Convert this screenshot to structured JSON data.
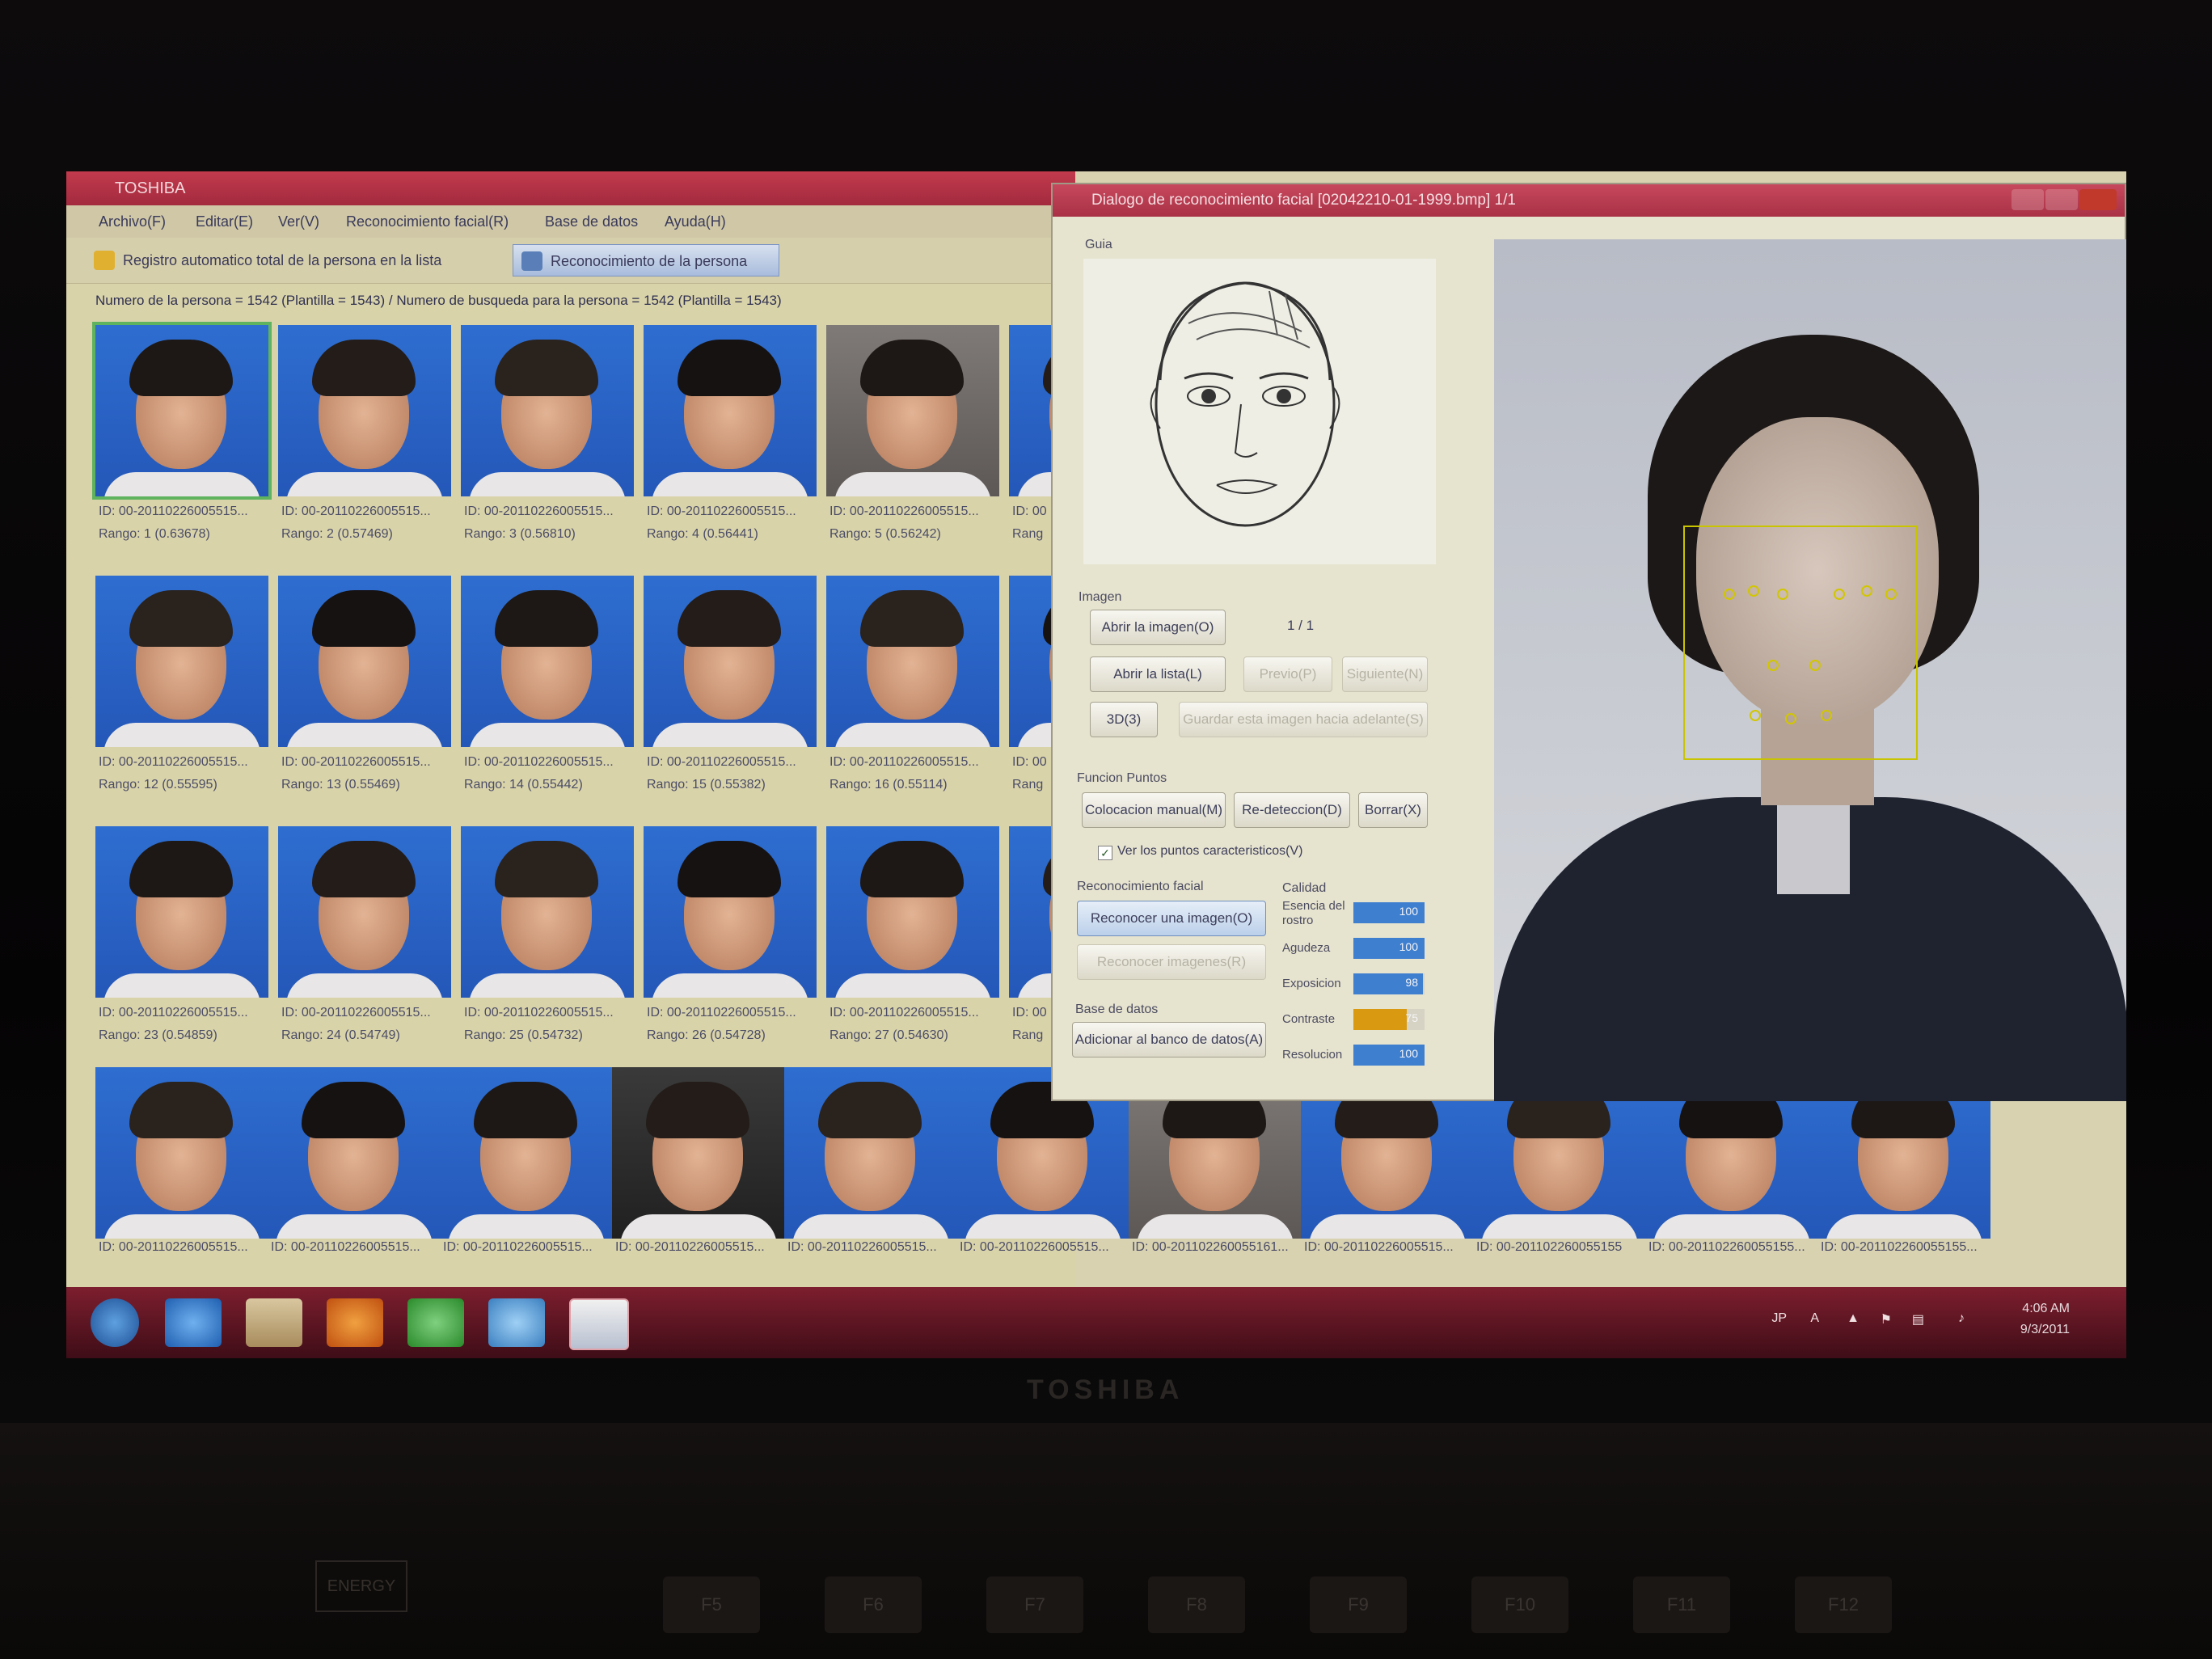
{
  "main_window": {
    "title": "TOSHIBA",
    "menu": [
      "Archivo(F)",
      "Editar(E)",
      "Ver(V)",
      "Reconocimiento facial(R)",
      "Base de datos",
      "Ayuda(H)"
    ],
    "toolbar": {
      "auto_register_label": "Registro automatico total de la persona en la lista",
      "person_recognition_label": "Reconocimiento de la persona"
    },
    "info_line": "Numero de la persona = 1542 (Plantilla = 1543)  /  Numero de busqueda para la persona = 1542 (Plantilla = 1543)",
    "results": [
      {
        "id": "ID: 00-20110226005515...",
        "rank": "Rango: 1 (0.63678)"
      },
      {
        "id": "ID: 00-20110226005515...",
        "rank": "Rango: 2 (0.57469)"
      },
      {
        "id": "ID: 00-20110226005515...",
        "rank": "Rango: 3 (0.56810)"
      },
      {
        "id": "ID: 00-20110226005515...",
        "rank": "Rango: 4 (0.56441)"
      },
      {
        "id": "ID: 00-20110226005515...",
        "rank": "Rango: 5 (0.56242)"
      },
      {
        "id": "ID: 00",
        "rank": "Rang"
      },
      {
        "id": "ID: 00-20110226005515...",
        "rank": "Rango: 12 (0.55595)"
      },
      {
        "id": "ID: 00-20110226005515...",
        "rank": "Rango: 13 (0.55469)"
      },
      {
        "id": "ID: 00-20110226005515...",
        "rank": "Rango: 14 (0.55442)"
      },
      {
        "id": "ID: 00-20110226005515...",
        "rank": "Rango: 15 (0.55382)"
      },
      {
        "id": "ID: 00-20110226005515...",
        "rank": "Rango: 16 (0.55114)"
      },
      {
        "id": "ID: 00",
        "rank": "Rang"
      },
      {
        "id": "ID: 00-20110226005515...",
        "rank": "Rango: 23 (0.54859)"
      },
      {
        "id": "ID: 00-20110226005515...",
        "rank": "Rango: 24 (0.54749)"
      },
      {
        "id": "ID: 00-20110226005515...",
        "rank": "Rango: 25 (0.54732)"
      },
      {
        "id": "ID: 00-20110226005515...",
        "rank": "Rango: 26 (0.54728)"
      },
      {
        "id": "ID: 00-20110226005515...",
        "rank": "Rango: 27 (0.54630)"
      },
      {
        "id": "ID: 00",
        "rank": "Rang"
      },
      {
        "id": "ID: 00-20110226005515...",
        "rank": ""
      },
      {
        "id": "ID: 00-20110226005515...",
        "rank": ""
      },
      {
        "id": "ID: 00-20110226005515...",
        "rank": ""
      },
      {
        "id": "ID: 00-20110226005515...",
        "rank": ""
      },
      {
        "id": "ID: 00-20110226005515...",
        "rank": ""
      },
      {
        "id": "ID: 00-20110226005515...",
        "rank": ""
      },
      {
        "id": "ID: 00-201102260055161...",
        "rank": ""
      },
      {
        "id": "ID: 00-20110226005515...",
        "rank": ""
      },
      {
        "id": "ID: 00-201102260055155",
        "rank": ""
      },
      {
        "id": "ID: 00-201102260055155...",
        "rank": ""
      },
      {
        "id": "ID: 00-201102260055155...",
        "rank": ""
      }
    ]
  },
  "dialog": {
    "title": "Dialogo de reconocimiento facial [02042210-01-1999.bmp] 1/1",
    "guide_label": "Guia",
    "image_group": "Imagen",
    "open_image": "Abrir la imagen(O)",
    "open_list": "Abrir la lista(L)",
    "page_counter": "1 / 1",
    "prev": "Previo(P)",
    "next": "Siguiente(N)",
    "threed": "3D(3)",
    "save_forward": "Guardar esta imagen hacia adelante(S)",
    "points_group": "Funcion Puntos",
    "manual_placement": "Colocacion manual(M)",
    "redetection": "Re-deteccion(D)",
    "delete": "Borrar(X)",
    "show_points": "Ver los puntos caracteristicos(V)",
    "recognition_group": "Reconocimiento facial",
    "recognize_one": "Reconocer una imagen(O)",
    "recognize_many": "Reconocer imagenes(R)",
    "database_group": "Base de datos",
    "add_to_db": "Adicionar al banco de datos(A)",
    "quality_group": "Calidad",
    "quality": [
      {
        "label": "Esencia del rostro",
        "value": 100,
        "display": "100",
        "color": "#3f7fd0"
      },
      {
        "label": "Agudeza",
        "value": 100,
        "display": "100",
        "color": "#3f7fd0"
      },
      {
        "label": "Exposicion",
        "value": 98,
        "display": "98",
        "color": "#3f7fd0"
      },
      {
        "label": "Contraste",
        "value": 75,
        "display": "75",
        "color": "#d99a12"
      },
      {
        "label": "Resolucion",
        "value": 100,
        "display": "100",
        "color": "#3f7fd0"
      }
    ]
  },
  "taskbar": {
    "ime": "JP",
    "time": "4:06 AM",
    "date": "9/3/2011"
  },
  "laptop": {
    "brand": "TOSHIBA",
    "fkeys": [
      "F5",
      "F6",
      "F7",
      "F8",
      "F9",
      "F10",
      "F11",
      "F12"
    ]
  }
}
